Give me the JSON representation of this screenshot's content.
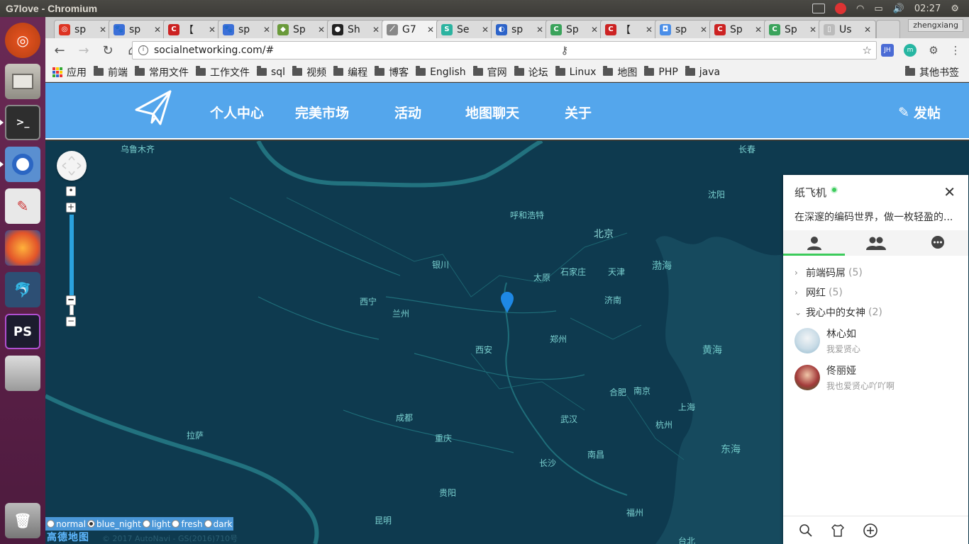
{
  "window": {
    "title": "G7love - Chromium"
  },
  "system_tray": {
    "user": "zhengxiang",
    "clock": "02:27"
  },
  "tabs": [
    {
      "label": "sp",
      "fav": "#d32",
      "favtxt": "◎"
    },
    {
      "label": "sp",
      "fav": "#3b6fd8",
      "favtxt": "🐾"
    },
    {
      "label": "【",
      "fav": "#c22",
      "favtxt": "C"
    },
    {
      "label": "sp",
      "fav": "#3b6fd8",
      "favtxt": "🐾"
    },
    {
      "label": "Sp",
      "fav": "#6a9a3a",
      "favtxt": "◆"
    },
    {
      "label": "Sh",
      "fav": "#222",
      "favtxt": "●"
    },
    {
      "label": "G7",
      "fav": "#888",
      "favtxt": "⟋"
    },
    {
      "label": "Se",
      "fav": "#2bb3a0",
      "favtxt": "S"
    },
    {
      "label": "sp",
      "fav": "#2c63c9",
      "favtxt": "◐"
    },
    {
      "label": "Sp",
      "fav": "#3aa35b",
      "favtxt": "C"
    },
    {
      "label": "【",
      "fav": "#c22",
      "favtxt": "C"
    },
    {
      "label": "sp",
      "fav": "#4a8ee8",
      "favtxt": "◘"
    },
    {
      "label": "Sp",
      "fav": "#c22",
      "favtxt": "C"
    },
    {
      "label": "Sp",
      "fav": "#3aa35b",
      "favtxt": "C"
    },
    {
      "label": "Us",
      "fav": "#bbb",
      "favtxt": "▯"
    }
  ],
  "toolbar": {
    "url": "socialnetworking.com/#"
  },
  "bookmarks": {
    "apps": "应用",
    "items": [
      "前端",
      "常用文件",
      "工作文件",
      "sql",
      "视频",
      "编程",
      "博客",
      "English",
      "官网",
      "论坛",
      "Linux",
      "地图",
      "PHP",
      "java"
    ],
    "other": "其他书签"
  },
  "site_nav": {
    "links": [
      "个人中心",
      "完美市场",
      "活动",
      "地图聊天",
      "关于"
    ],
    "post": "发帖"
  },
  "map": {
    "cities": [
      {
        "name": "乌鲁木齐"
      },
      {
        "name": "长春"
      },
      {
        "name": "沈阳"
      },
      {
        "name": "呼和浩特"
      },
      {
        "name": "北京"
      },
      {
        "name": "银川"
      },
      {
        "name": "太原"
      },
      {
        "name": "石家庄"
      },
      {
        "name": "天津"
      },
      {
        "name": "西宁"
      },
      {
        "name": "兰州"
      },
      {
        "name": "济南"
      },
      {
        "name": "郑州"
      },
      {
        "name": "西安"
      },
      {
        "name": "合肥"
      },
      {
        "name": "南京"
      },
      {
        "name": "成都"
      },
      {
        "name": "武汉"
      },
      {
        "name": "上海"
      },
      {
        "name": "杭州"
      },
      {
        "name": "拉萨"
      },
      {
        "name": "重庆"
      },
      {
        "name": "长沙"
      },
      {
        "name": "南昌"
      },
      {
        "name": "贵阳"
      },
      {
        "name": "昆明"
      },
      {
        "name": "福州"
      },
      {
        "name": "台北"
      }
    ],
    "seas": [
      "渤海",
      "黄海",
      "东海"
    ],
    "styles": [
      "normal",
      "blue_night",
      "light",
      "fresh",
      "dark"
    ],
    "selected_style": "blue_night",
    "provider": "高德地图",
    "copyright": "© 2017 AutoNavi - GS(2016)710号"
  },
  "chat": {
    "name": "纸飞机",
    "signature": "在深邃的编码世界，做一枚轻盈的...",
    "groups": [
      {
        "name": "前端码屌",
        "count": "(5)"
      },
      {
        "name": "网红",
        "count": "(5)"
      },
      {
        "name": "我心中的女神",
        "count": "(2)"
      }
    ],
    "friends": [
      {
        "name": "林心如",
        "sign": "我爱贤心"
      },
      {
        "name": "佟丽娅",
        "sign": "我也爱贤心吖吖啊"
      }
    ]
  }
}
